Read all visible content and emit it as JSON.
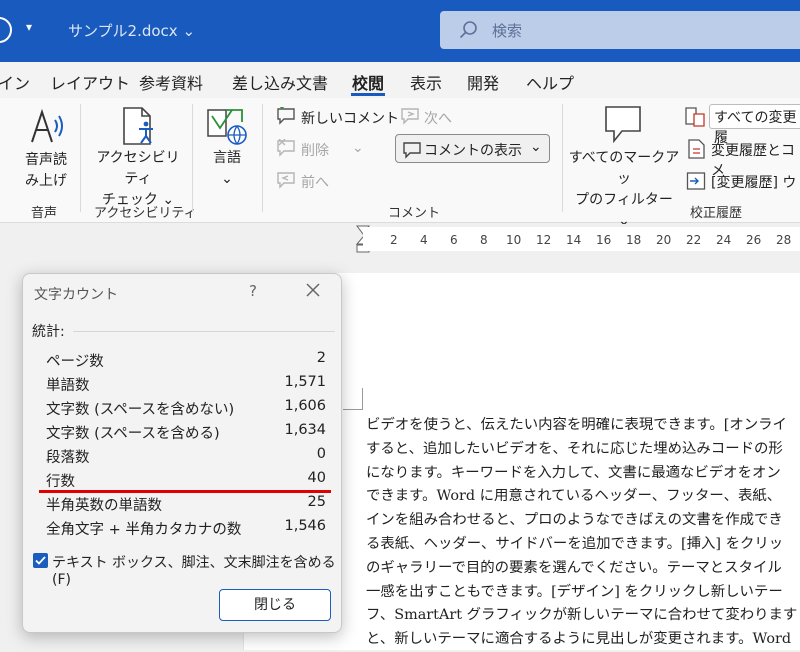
{
  "titlebar": {
    "filename": "サンプル2.docx",
    "search_placeholder": "検索"
  },
  "tabs": [
    "イン",
    "レイアウト",
    "参考資料",
    "差し込み文書",
    "校閲",
    "表示",
    "開発",
    "ヘルプ"
  ],
  "active_tab": "校閲",
  "ribbon": {
    "read_aloud": "音声読\nみ上げ",
    "read_aloud_line1": "音声読",
    "read_aloud_line2": "み上げ",
    "group_speech": "音声",
    "accessibility_line1": "アクセシビリティ",
    "accessibility_line2": "チェック ⌄",
    "group_accessibility": "アクセシビリティ",
    "language": "言語",
    "language_arrow": "⌄",
    "new_comment": "新しいコメント",
    "delete": "削除",
    "delete_arrow": "⌄",
    "previous": "前へ",
    "next": "次へ",
    "show_comments": "コメントの表示",
    "show_comments_arrow": "⌄",
    "group_comments": "コメント",
    "markup_filter_line1": "すべてのマークアッ",
    "markup_filter_line2": "プのフィルター ⌄",
    "all_changes": "すべての変更履",
    "track_changes": "変更履歴とコメ",
    "track_pane": "[変更履歴] ウ",
    "group_tracking": "校正履歴"
  },
  "ruler": [
    "2",
    "4",
    "6",
    "8",
    "10",
    "12",
    "14",
    "16",
    "18",
    "20",
    "22",
    "24",
    "26",
    "28"
  ],
  "document": {
    "lines": [
      "ビデオを使うと、伝えたい内容を明確に表現できます。[オンライ",
      "すると、追加したいビデオを、それに応じた埋め込みコードの形",
      "になります。キーワードを入力して、文書に最適なビデオをオン",
      "できます。Word に用意されているヘッダー、フッター、表紙、",
      "インを組み合わせると、プロのようなできばえの文書を作成でき",
      "る表紙、ヘッダー、サイドバーを追加できます。[挿入] をクリッ",
      "のギャラリーで目的の要素を選んでください。テーマとスタイル",
      "一感を出すこともできます。[デザイン] をクリックし新しいテー",
      "フ、SmartArt グラフィックが新しいテーマに合わせて変わります",
      "と、新しいテーマに適合するように見出しが変更されます。Word"
    ]
  },
  "dialog": {
    "title": "文字カウント",
    "help": "?",
    "stats_label": "統計:",
    "stats": [
      {
        "label": "ページ数",
        "value": "2"
      },
      {
        "label": "単語数",
        "value": "1,571"
      },
      {
        "label": "文字数 (スペースを含めない)",
        "value": "1,606"
      },
      {
        "label": "文字数 (スペースを含める)",
        "value": "1,634"
      },
      {
        "label": "段落数",
        "value": "0"
      },
      {
        "label": "行数",
        "value": "40"
      },
      {
        "label": "半角英数の単語数",
        "value": "25"
      },
      {
        "label": "全角文字 + 半角カタカナの数",
        "value": "1,546"
      }
    ],
    "include_textboxes": "テキスト ボックス、脚注、文末脚注を含める(F)",
    "include_checked": true,
    "close_button": "閉じる"
  },
  "colors": {
    "titlebar": "#185abd",
    "accent": "#1b5dbf",
    "highlight_line": "#e00000"
  }
}
